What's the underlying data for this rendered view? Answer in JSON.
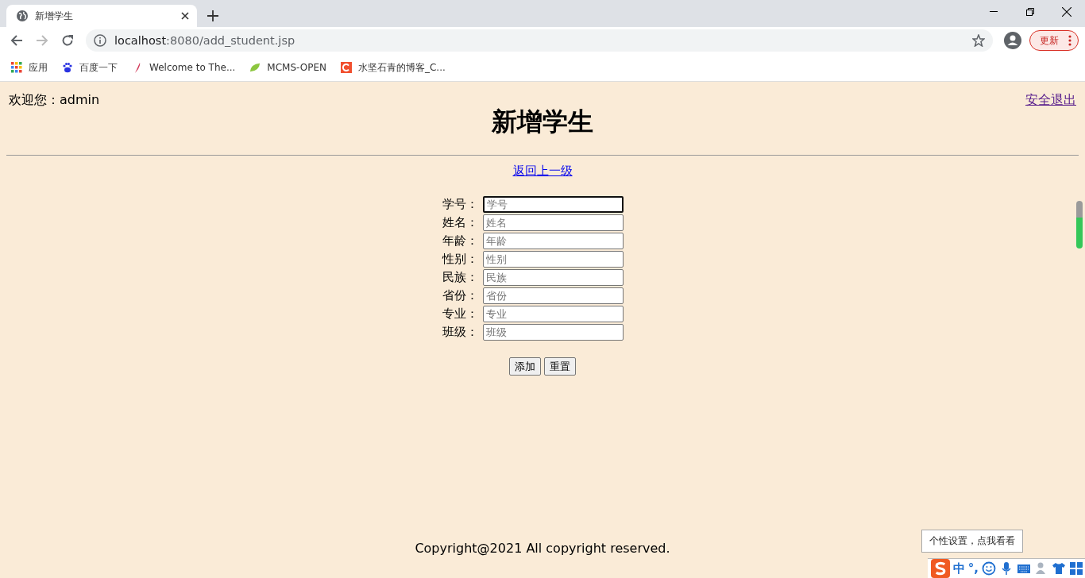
{
  "browser": {
    "tab": {
      "title": "新增学生"
    },
    "address": {
      "host": "localhost",
      "path": ":8080/add_student.jsp"
    },
    "update_button": "更新",
    "bookmarks": [
      {
        "kind": "apps",
        "label": "应用"
      },
      {
        "kind": "paw",
        "label": "百度一下"
      },
      {
        "kind": "feather",
        "label": "Welcome to The..."
      },
      {
        "kind": "leaf",
        "label": "MCMS-OPEN"
      },
      {
        "kind": "c-logo",
        "label": "水坚石青的博客_C..."
      }
    ]
  },
  "page": {
    "welcome": "欢迎您：admin",
    "logout": "安全退出",
    "heading": "新增学生",
    "back_link": "返回上一级",
    "fields": [
      {
        "label": "学号：",
        "placeholder": "学号",
        "focused": true
      },
      {
        "label": "姓名：",
        "placeholder": "姓名",
        "focused": false
      },
      {
        "label": "年龄：",
        "placeholder": "年龄",
        "focused": false
      },
      {
        "label": "性别：",
        "placeholder": "性别",
        "focused": false
      },
      {
        "label": "民族：",
        "placeholder": "民族",
        "focused": false
      },
      {
        "label": "省份：",
        "placeholder": "省份",
        "focused": false
      },
      {
        "label": "专业：",
        "placeholder": "专业",
        "focused": false
      },
      {
        "label": "班级：",
        "placeholder": "班级",
        "focused": false
      }
    ],
    "buttons": [
      "添加",
      "重置"
    ],
    "footer": "Copyright@2021 All copyright reserved."
  },
  "ime": {
    "tooltip": "个性设置，点我看看",
    "mode": "中",
    "punctuation": "°,"
  }
}
